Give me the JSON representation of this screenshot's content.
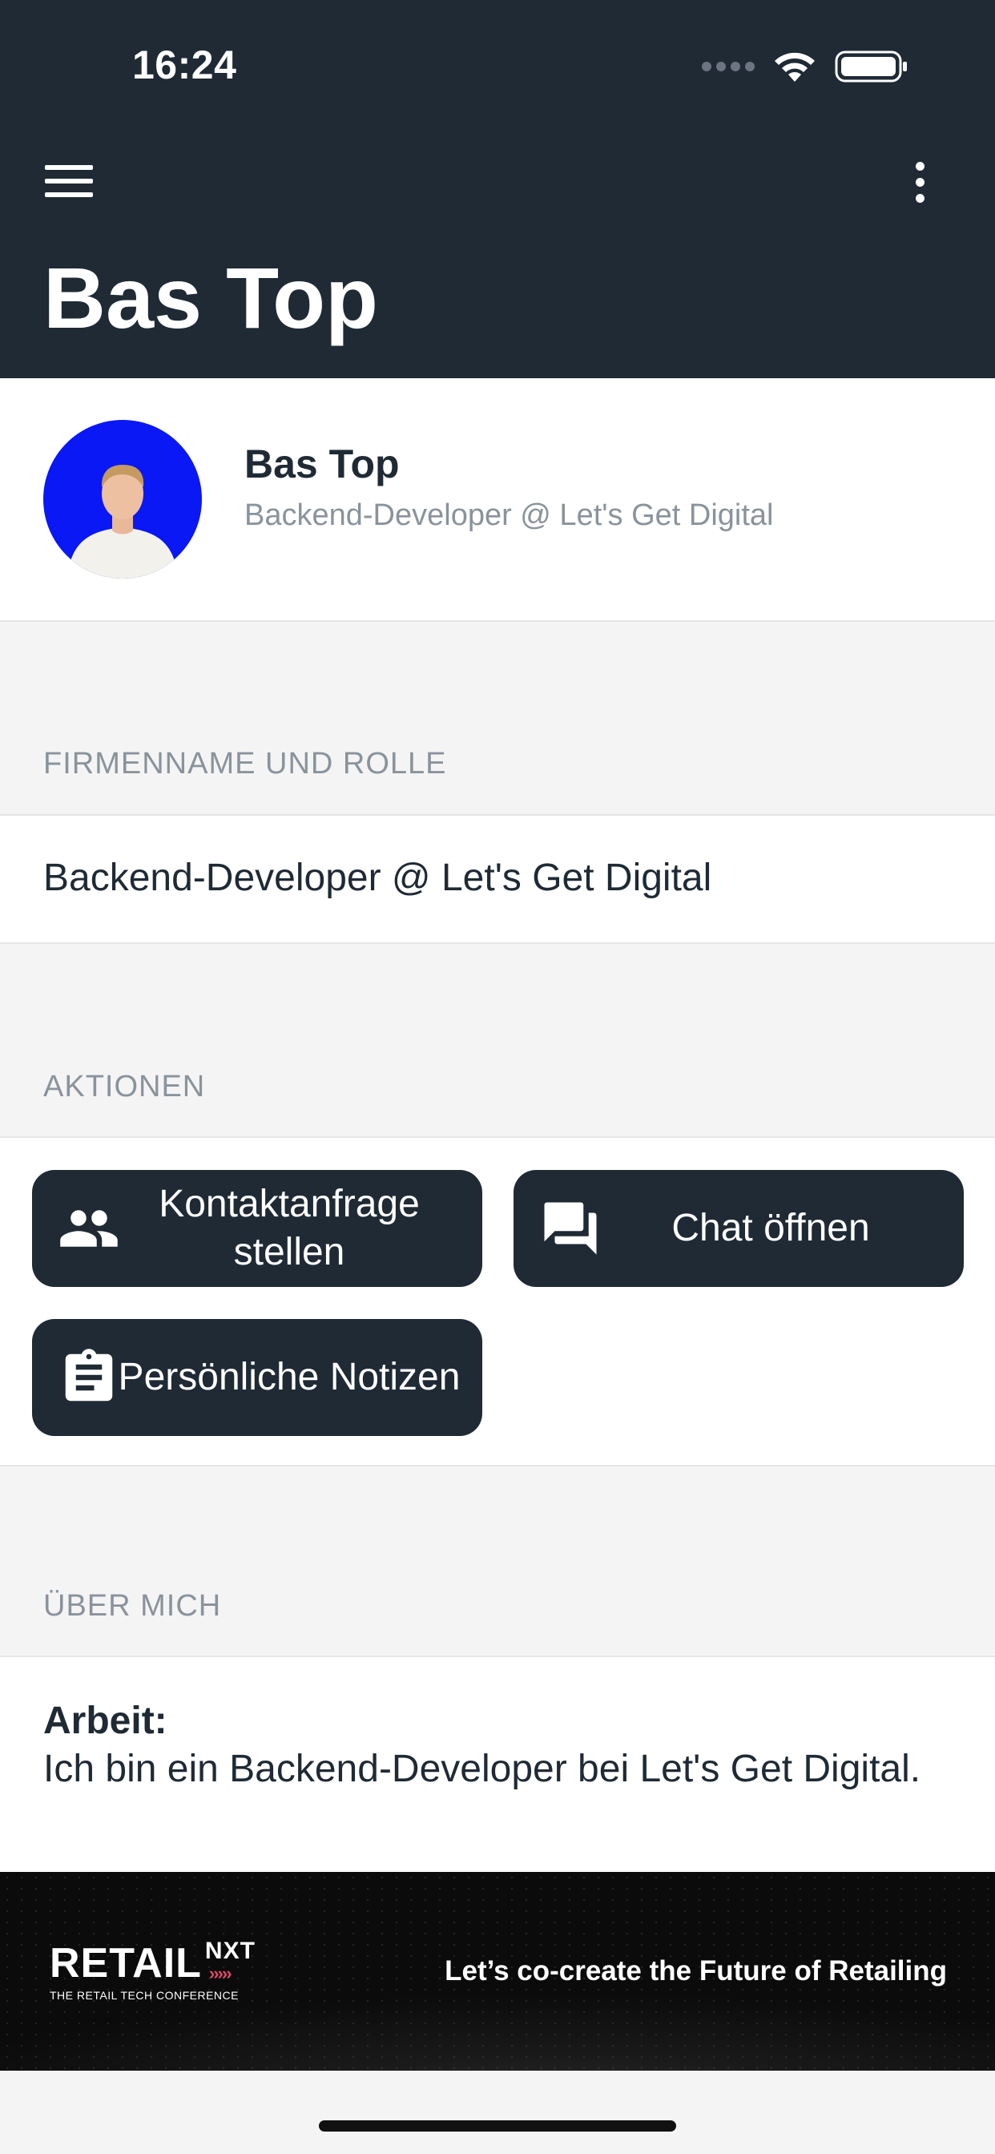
{
  "status_bar": {
    "time": "16:24"
  },
  "header": {
    "title": "Bas Top"
  },
  "profile": {
    "name": "Bas Top",
    "subtitle": "Backend-Developer @ Let's Get Digital"
  },
  "company_section": {
    "header": "FIRMENNAME UND ROLLE",
    "value": "Backend-Developer @ Let's Get Digital"
  },
  "actions_section": {
    "header": "AKTIONEN",
    "buttons": [
      {
        "label": "Kontaktanfrage stellen",
        "icon": "people-icon"
      },
      {
        "label": "Chat öffnen",
        "icon": "chat-icon"
      },
      {
        "label": "Persönliche Notizen",
        "icon": "clipboard-icon"
      }
    ]
  },
  "about_section": {
    "header": "ÜBER MICH",
    "title": "Arbeit:",
    "text": "Ich bin ein Backend-Developer bei Let's Get Digital."
  },
  "banner": {
    "logo_main": "RETAIL",
    "logo_suffix": "NXT",
    "logo_chevrons": "›››››",
    "logo_sub": "THE RETAIL TECH CONFERENCE",
    "tagline": "Let’s co-create the Future of Retailing"
  },
  "colors": {
    "primary": "#1f2a35",
    "background": "#f4f4f4",
    "muted_text": "#8a939c",
    "avatar_bg": "#0a18f5",
    "logo_accent": "#e24a6a"
  }
}
